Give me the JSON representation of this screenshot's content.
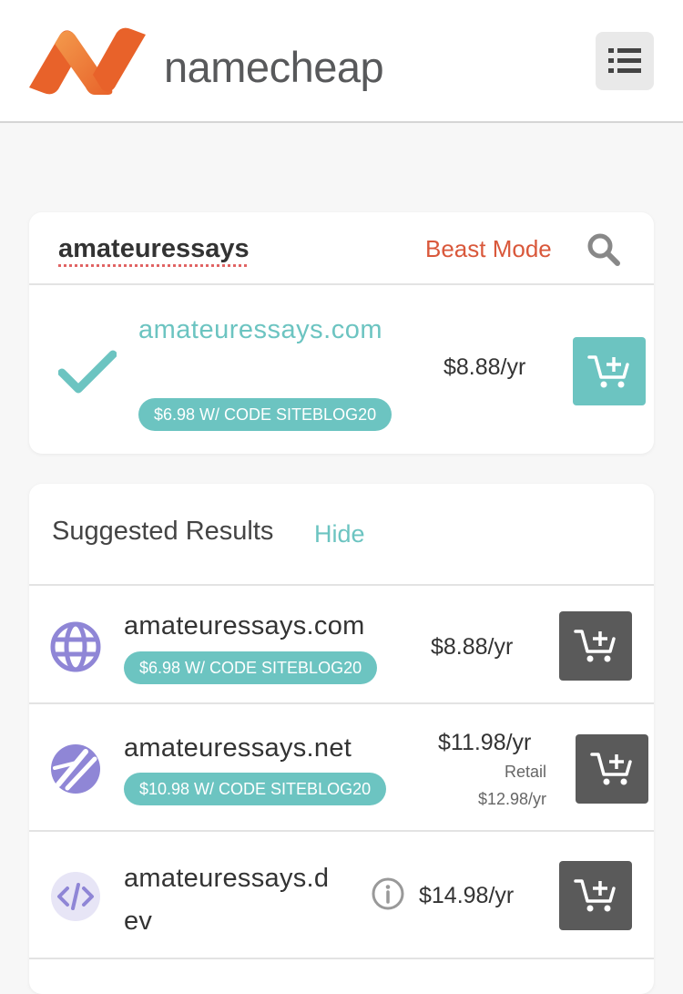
{
  "header": {
    "logo_text": "namecheap",
    "colors": {
      "logo_orange": "#e8622a",
      "logo_light": "#f28b3c"
    },
    "menu_icon": "list-menu-icon"
  },
  "search": {
    "query": "amateuressays",
    "beast_mode_label": "Beast Mode",
    "search_icon": "search-icon"
  },
  "main_result": {
    "domain": "amateuressays.com",
    "domain_display": "amateuressays.co m",
    "available_icon": "checkmark-icon",
    "promo": "$6.98 W/ CODE SITEBLOG20",
    "price": "$8.88/yr",
    "cart_icon": "add-to-cart-icon",
    "accent_color": "#6cc4c1"
  },
  "suggested": {
    "title": "Suggested Results",
    "hide_label": "Hide",
    "items": [
      {
        "icon": "globe-icon",
        "domain": "amateuressays.com",
        "promo": "$6.98 W/ CODE SITEBLOG20",
        "price": "$8.88/yr"
      },
      {
        "icon": "net-logo-icon",
        "domain": "amateuressays.net",
        "promo": "$10.98 W/ CODE SITEBLOG20",
        "price": "$11.98/yr",
        "retail_label": "Retail",
        "retail_price": "$12.98/yr"
      },
      {
        "icon": "code-brackets-icon",
        "domain": "amateuressays.dev",
        "domain_line1": "amateuressays.d",
        "domain_line2": "ev",
        "info_icon": "info-icon",
        "price": "$14.98/yr"
      }
    ]
  }
}
